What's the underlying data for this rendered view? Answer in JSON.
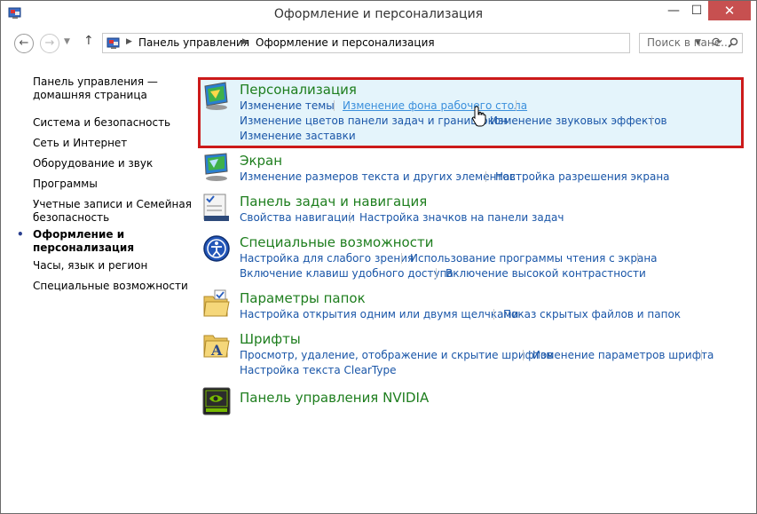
{
  "window": {
    "title": "Оформление и персонализация",
    "close_glyph": "✕",
    "min_glyph": "—",
    "max_glyph": "☐"
  },
  "address": {
    "crumbs": [
      "Панель управления",
      "Оформление и персонализация"
    ],
    "search_placeholder": "Поиск в пане..."
  },
  "sidebar": {
    "items": [
      {
        "label": "Панель управления — домашняя страница",
        "active": false
      },
      {
        "label": "Система и безопасность",
        "active": false
      },
      {
        "label": "Сеть и Интернет",
        "active": false
      },
      {
        "label": "Оборудование и звук",
        "active": false
      },
      {
        "label": "Программы",
        "active": false
      },
      {
        "label": "Учетные записи и Семейная безопасность",
        "active": false
      },
      {
        "label": "Оформление и персонализация",
        "active": true
      },
      {
        "label": "Часы, язык и регион",
        "active": false
      },
      {
        "label": "Специальные возможности",
        "active": false
      }
    ],
    "home_line1": "Панель управления —",
    "home_line2": "домашняя страница",
    "accounts_line1": "Учетные записи и Семейная",
    "accounts_line2": "безопасность",
    "appearance_line1": "Оформление и",
    "appearance_line2": "персонализация"
  },
  "categories": {
    "personalization": {
      "title": "Персонализация",
      "links": [
        "Изменение темы",
        "Изменение фона рабочего стола",
        "Изменение цветов панели задач и границ окон",
        "Изменение звуковых эффектов",
        "Изменение заставки"
      ]
    },
    "display": {
      "title": "Экран",
      "links": [
        "Изменение размеров текста и других элементов",
        "Настройка разрешения экрана"
      ]
    },
    "taskbar": {
      "title": "Панель задач и навигация",
      "links": [
        "Свойства навигации",
        "Настройка значков на панели задач"
      ]
    },
    "ease": {
      "title": "Специальные возможности",
      "links": [
        "Настройка для слабого зрения",
        "Использование программы чтения с экрана",
        "Включение клавиш удобного доступа",
        "Включение высокой контрастности"
      ]
    },
    "folders": {
      "title": "Параметры папок",
      "links": [
        "Настройка открытия одним или двумя щелчками",
        "Показ скрытых файлов и папок"
      ]
    },
    "fonts": {
      "title": "Шрифты",
      "links": [
        "Просмотр, удаление, отображение и скрытие шрифтов",
        "Изменение параметров шрифта",
        "Настройка текста ClearType"
      ]
    },
    "nvidia": {
      "title": "Панель управления NVIDIA"
    }
  },
  "colors": {
    "category_title": "#1e7e1e",
    "link": "#1a56a8",
    "highlight_border": "#cc1a1a",
    "highlight_fill": "#e4f4fb",
    "close_button": "#c75050"
  }
}
